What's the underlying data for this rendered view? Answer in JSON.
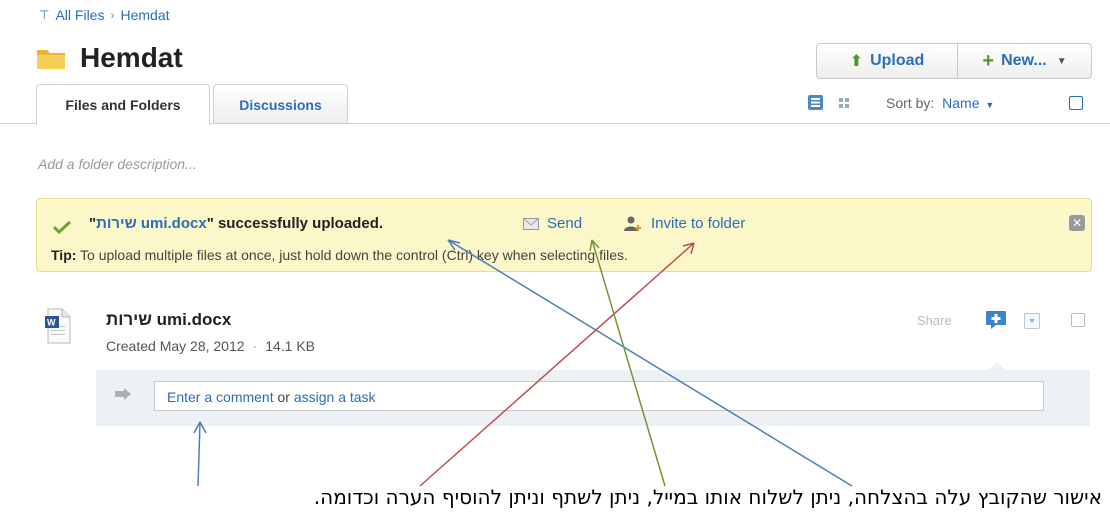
{
  "breadcrumb": {
    "root": "All Files",
    "current": "Hemdat"
  },
  "folder": {
    "title": "Hemdat",
    "description_placeholder": "Add a folder description..."
  },
  "toolbar": {
    "upload_label": "Upload",
    "new_label": "New..."
  },
  "tabs": [
    {
      "label": "Files and Folders",
      "active": true
    },
    {
      "label": "Discussions",
      "active": false
    }
  ],
  "view": {
    "sort_label": "Sort by:",
    "sort_value": "Name"
  },
  "notice": {
    "quote_open": "\"",
    "file_name": "שירות umi.docx",
    "message_rest": "\" successfully uploaded.",
    "send_label": "Send",
    "invite_label": "Invite to folder",
    "tip_label": "Tip:",
    "tip_text": " To upload multiple files at once, just hold down the control (Ctrl) key when selecting files."
  },
  "file": {
    "name": "שירות umi.docx",
    "created": "Created May 28, 2012",
    "size": "14.1 KB",
    "share_label": "Share"
  },
  "comment": {
    "enter_comment": "Enter a comment",
    "or": " or ",
    "assign_task": "assign a task"
  },
  "caption": "אישור שהקובץ עלה בהצלחה, ניתן לשלוח אותו במייל, ניתן לשתף וניתן להוסיף הערה וכדומה.",
  "colors": {
    "link": "#2a6ebb",
    "notice_bg": "#fbf7c9",
    "arrow_blue": "#4a7ebb",
    "arrow_red": "#c0504d",
    "arrow_green": "#77933c"
  }
}
